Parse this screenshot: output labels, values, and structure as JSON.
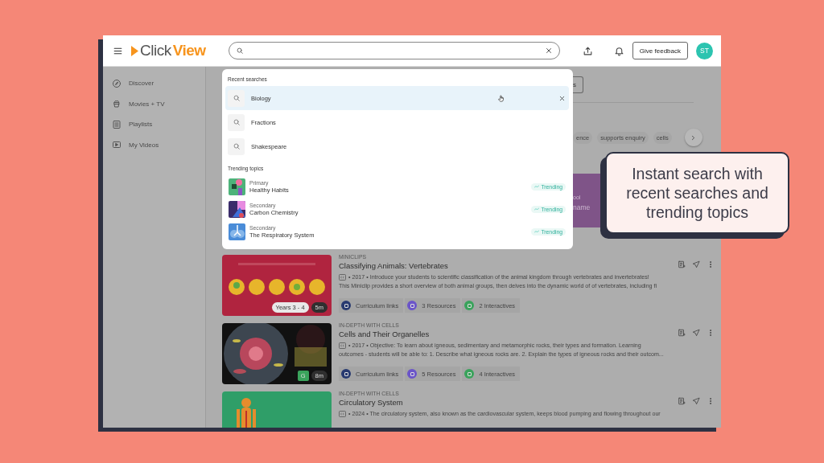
{
  "header": {
    "logo": {
      "part_1": "Click",
      "part_2": "View"
    },
    "feedback_button": "Give feedback",
    "avatar": "ST"
  },
  "sidebar": {
    "items": [
      {
        "label": "Discover"
      },
      {
        "label": "Movies + TV"
      },
      {
        "label": "Playlists"
      },
      {
        "label": "My Videos"
      }
    ]
  },
  "search_dropdown": {
    "recent_title": "Recent searches",
    "recent": [
      {
        "label": "Biology",
        "selected": true
      },
      {
        "label": "Fractions",
        "selected": false
      },
      {
        "label": "Shakespeare",
        "selected": false
      }
    ],
    "trending_title": "Trending topics",
    "trending": [
      {
        "level": "Primary",
        "title": "Healthy Habits",
        "badge": "Trending"
      },
      {
        "level": "Secondary",
        "title": "Carbon Chemistry",
        "badge": "Trending"
      },
      {
        "level": "Secondary",
        "title": "The Respiratory System",
        "badge": "Trending"
      }
    ]
  },
  "background": {
    "button_fragment": "s",
    "tags": [
      "ence",
      "supports enquiry",
      "cells"
    ],
    "card_lines": [
      "ool",
      "name"
    ]
  },
  "videos": [
    {
      "category": "MINICLIPS",
      "title": "Classifying Animals: Vertebrates",
      "description": [
        "• 2017 •  Introduce your students to scientific classification of the animal kingdom through vertebrates and invertebrates!",
        "This Miniclip provides a short overview of both animal groups, then delves into the dynamic world of of vertebrates, including fi"
      ],
      "badges": [
        {
          "kind": "level",
          "text": "Years 3 - 4"
        },
        {
          "kind": "duration",
          "text": "5m"
        }
      ],
      "chips": [
        "Curriculum links",
        "3 Resources",
        "2 Interactives"
      ]
    },
    {
      "category": "IN-DEPTH WITH CELLS",
      "title": "Cells and Their Organelles",
      "description": [
        "• 2017 • Objective: To learn about igneous, sedimentary and metamorphic rocks, their types and formation. Learning",
        "outcomes - students will be able to: 1. Describe what igneous rocks are. 2. Explain the types of igneous rocks and their outcom..."
      ],
      "badges": [
        {
          "kind": "grade",
          "text": "G"
        },
        {
          "kind": "duration",
          "text": "8m"
        }
      ],
      "chips": [
        "Curriculum links",
        "5 Resources",
        "4 Interactives"
      ]
    },
    {
      "category": "IN-DEPTH WITH CELLS",
      "title": "Circulatory System",
      "description": [
        "• 2024 • The circulatory system, also known as the cardiovascular system, keeps blood pumping and flowing throughout our"
      ]
    }
  ],
  "callout": "Instant search with recent searches and trending topics"
}
